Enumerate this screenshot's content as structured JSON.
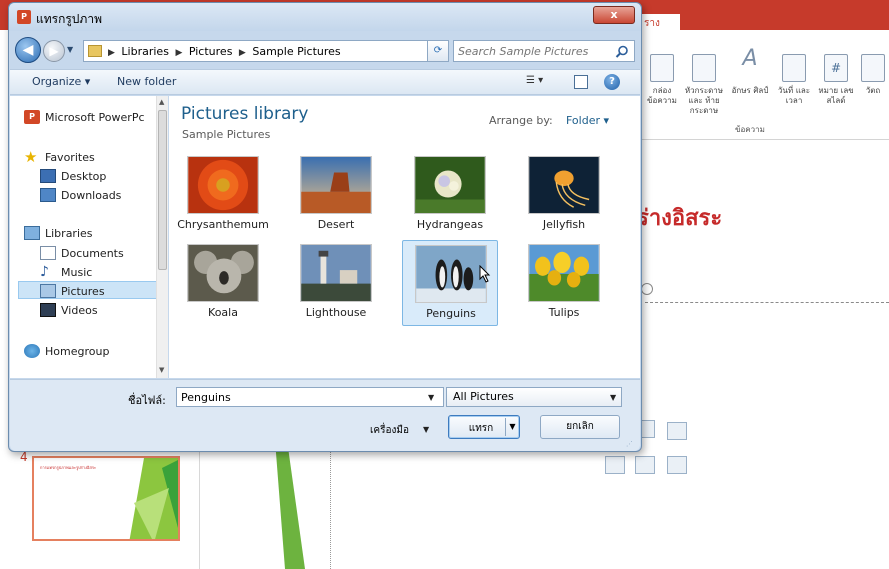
{
  "dialog": {
    "title": "แทรกรูปภาพ",
    "app_icon": "P",
    "close_label": "x"
  },
  "address": {
    "crumbs": [
      "Libraries",
      "Pictures",
      "Sample Pictures"
    ],
    "search_placeholder": "Search Sample Pictures"
  },
  "toolbar": {
    "organize_label": "Organize ▾",
    "new_folder_label": "New folder"
  },
  "nav": {
    "items": [
      {
        "label": "Microsoft PowerPc",
        "icon": "powerpoint-icon"
      },
      {
        "label": "Favorites",
        "icon": "star-icon"
      },
      {
        "label": "Desktop",
        "icon": "desktop-icon"
      },
      {
        "label": "Downloads",
        "icon": "downloads-icon"
      },
      {
        "label": "Libraries",
        "icon": "libraries-icon"
      },
      {
        "label": "Documents",
        "icon": "documents-icon"
      },
      {
        "label": "Music",
        "icon": "music-icon"
      },
      {
        "label": "Pictures",
        "icon": "pictures-icon"
      },
      {
        "label": "Videos",
        "icon": "videos-icon"
      },
      {
        "label": "Homegroup",
        "icon": "homegroup-icon"
      }
    ],
    "selected": "Pictures"
  },
  "content": {
    "title": "Pictures library",
    "subtitle": "Sample Pictures",
    "arrange_label": "Arrange by:",
    "arrange_value": "Folder ▾",
    "pictures": [
      {
        "name": "Chrysanthemum"
      },
      {
        "name": "Desert"
      },
      {
        "name": "Hydrangeas"
      },
      {
        "name": "Jellyfish"
      },
      {
        "name": "Koala"
      },
      {
        "name": "Lighthouse"
      },
      {
        "name": "Penguins"
      },
      {
        "name": "Tulips"
      }
    ],
    "selected_picture": "Penguins"
  },
  "footer": {
    "filename_label": "ชื่อไฟล์:",
    "filename_value": "Penguins",
    "filetype_value": "All Pictures",
    "tools_label": "เครื่องมือ",
    "insert_label": "แทรก",
    "cancel_label": "ยกเลิก"
  },
  "powerpoint": {
    "tab_stub": "ราง",
    "ribbon_items": [
      {
        "label": "กล่อง ข้อความ"
      },
      {
        "label": "หัวกระดาษและ ท้ายกระดาษ"
      },
      {
        "label": "อักษร ศิลป์"
      },
      {
        "label": "วันที่ และเวลา"
      },
      {
        "label": "หมาย เลขสไลด์"
      },
      {
        "label": "วัตถ"
      }
    ],
    "ribbon_group": "ข้อความ",
    "slide_text": "ร่างอิสระ",
    "slide_number": "4",
    "thumb_title": "การแทรกรูปภาพและรูปร่างอิสระ"
  },
  "colors": {
    "ppt_red": "#c63a2b",
    "dialog_frame": "#c6d8ec",
    "link_blue": "#1e5f8c",
    "selection": "#d9ebfa"
  }
}
